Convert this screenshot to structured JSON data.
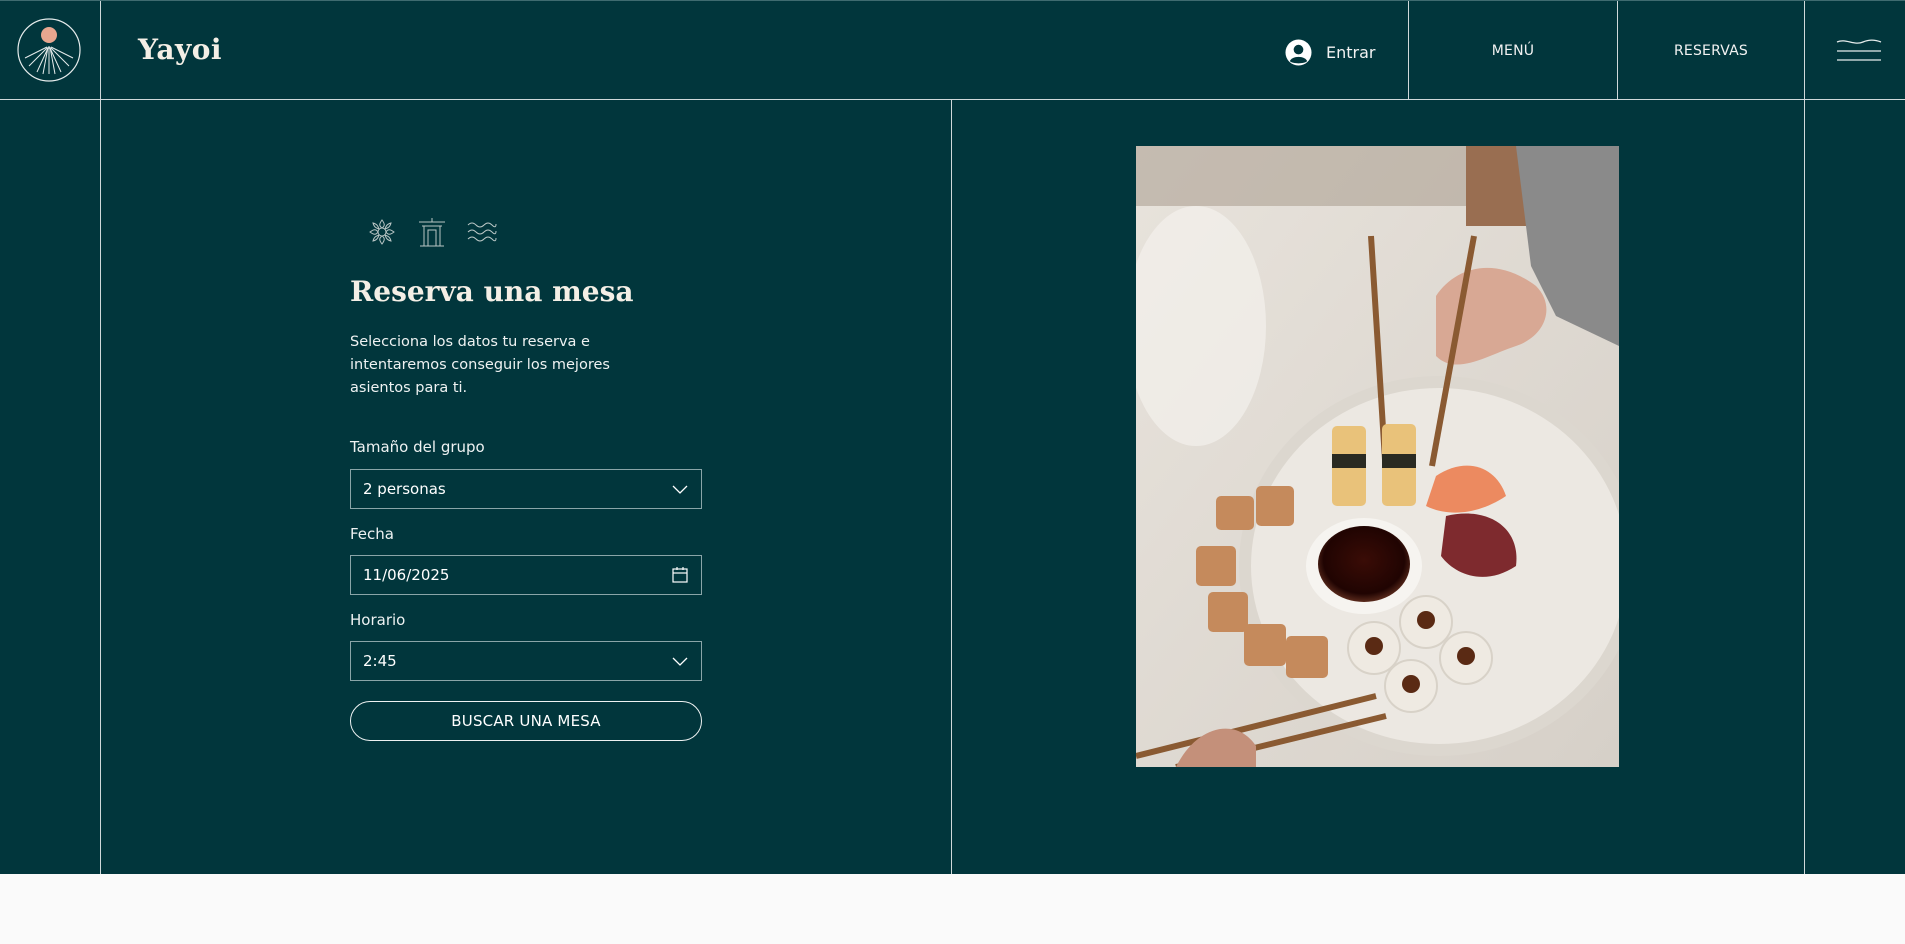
{
  "colors": {
    "background": "#01363c",
    "text": "#ffffff",
    "accent_sun": "#e8a68f",
    "footer": "#fafafa"
  },
  "header": {
    "brand": "Yayoi",
    "login_label": "Entrar",
    "nav": [
      {
        "label": "MENÚ"
      },
      {
        "label": "RESERVAS"
      }
    ],
    "icons": {
      "logo": "sun-logo-icon",
      "login": "user-avatar-icon",
      "menu": "hamburger-waves-icon"
    }
  },
  "reservation": {
    "motif_icons": [
      "flower-icon",
      "shrine-icon",
      "waves-icon"
    ],
    "title": "Reserva una mesa",
    "description": "Selecciona los datos tu reserva e intentaremos conseguir los mejores asientos para ti.",
    "party_size": {
      "label": "Tamaño del grupo",
      "value": "2 personas",
      "icon": "chevron-down-icon"
    },
    "date": {
      "label": "Fecha",
      "value": "11/06/2025",
      "icon": "calendar-icon"
    },
    "time": {
      "label": "Horario",
      "value": "2:45",
      "icon": "chevron-down-icon"
    },
    "submit_label": "BUSCAR UNA MESA"
  }
}
